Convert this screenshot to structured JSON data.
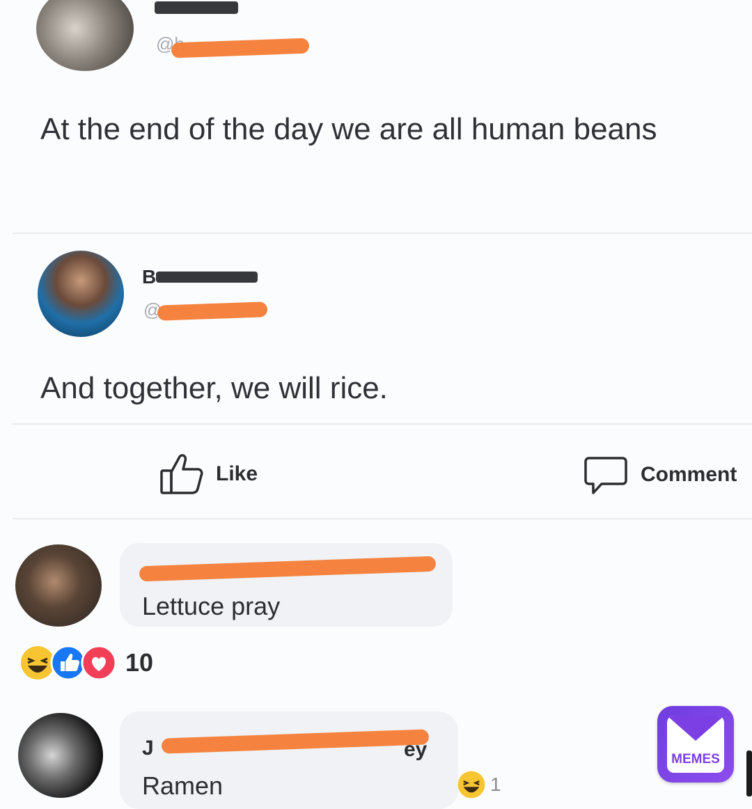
{
  "post1": {
    "handle": "@h",
    "text": "At the end of the day we are all human beans"
  },
  "post2": {
    "name": "B",
    "handle": "@",
    "text": "And together, we will rice."
  },
  "actions": {
    "like_label": "Like",
    "comment_label": "Comment"
  },
  "comments": [
    {
      "text": "Lettuce pray",
      "reaction_count": "10"
    },
    {
      "name_start": "J",
      "name_end": "ey",
      "text": "Ramen",
      "reaction_count": "1"
    }
  ],
  "watermark": {
    "label": "MEMES",
    "color": "#7b3fe4"
  },
  "colors": {
    "redaction": "#f47c35",
    "like_blue": "#1877f2",
    "love_red": "#f33e58",
    "haha_yellow": "#f7c531"
  }
}
